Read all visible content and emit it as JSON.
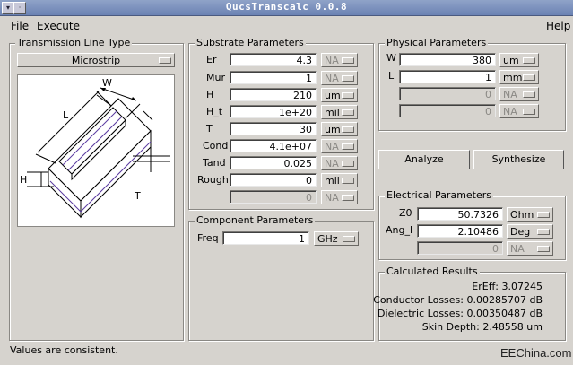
{
  "window": {
    "title": "QucsTranscalc 0.0.8"
  },
  "menu": {
    "file": "File",
    "execute": "Execute",
    "help": "Help"
  },
  "tline": {
    "title": "Transmission Line Type",
    "type": "Microstrip",
    "diagram_labels": {
      "w": "W",
      "l": "L",
      "h": "H",
      "t": "T"
    }
  },
  "substrate": {
    "title": "Substrate Parameters",
    "rows": [
      {
        "label": "Er",
        "value": "4.3",
        "unit": "NA"
      },
      {
        "label": "Mur",
        "value": "1",
        "unit": "NA"
      },
      {
        "label": "H",
        "value": "210",
        "unit": "um"
      },
      {
        "label": "H_t",
        "value": "1e+20",
        "unit": "mil"
      },
      {
        "label": "T",
        "value": "30",
        "unit": "um"
      },
      {
        "label": "Cond",
        "value": "4.1e+07",
        "unit": "NA"
      },
      {
        "label": "Tand",
        "value": "0.025",
        "unit": "NA"
      },
      {
        "label": "Rough",
        "value": "0",
        "unit": "mil"
      },
      {
        "label": "",
        "value": "0",
        "unit": "NA"
      }
    ]
  },
  "component": {
    "title": "Component Parameters",
    "freq_label": "Freq",
    "freq_value": "1",
    "freq_unit": "GHz"
  },
  "physical": {
    "title": "Physical Parameters",
    "rows": [
      {
        "label": "W",
        "value": "380",
        "unit": "um"
      },
      {
        "label": "L",
        "value": "1",
        "unit": "mm"
      },
      {
        "label": "",
        "value": "0",
        "unit": "NA"
      },
      {
        "label": "",
        "value": "0",
        "unit": "NA"
      }
    ]
  },
  "actions": {
    "analyze": "Analyze",
    "synthesize": "Synthesize"
  },
  "electrical": {
    "title": "Electrical Parameters",
    "rows": [
      {
        "label": "Z0",
        "value": "50.7326",
        "unit": "Ohm"
      },
      {
        "label": "Ang_l",
        "value": "2.10486",
        "unit": "Deg"
      },
      {
        "label": "",
        "value": "0",
        "unit": "NA"
      }
    ]
  },
  "results": {
    "title": "Calculated Results",
    "lines": [
      "ErEff: 3.07245",
      "Conductor Losses: 0.00285707 dB",
      "Dielectric Losses: 0.00350487 dB",
      "Skin Depth: 2.48558 um"
    ]
  },
  "status": "Values are consistent.",
  "watermark": "EEChina.com"
}
